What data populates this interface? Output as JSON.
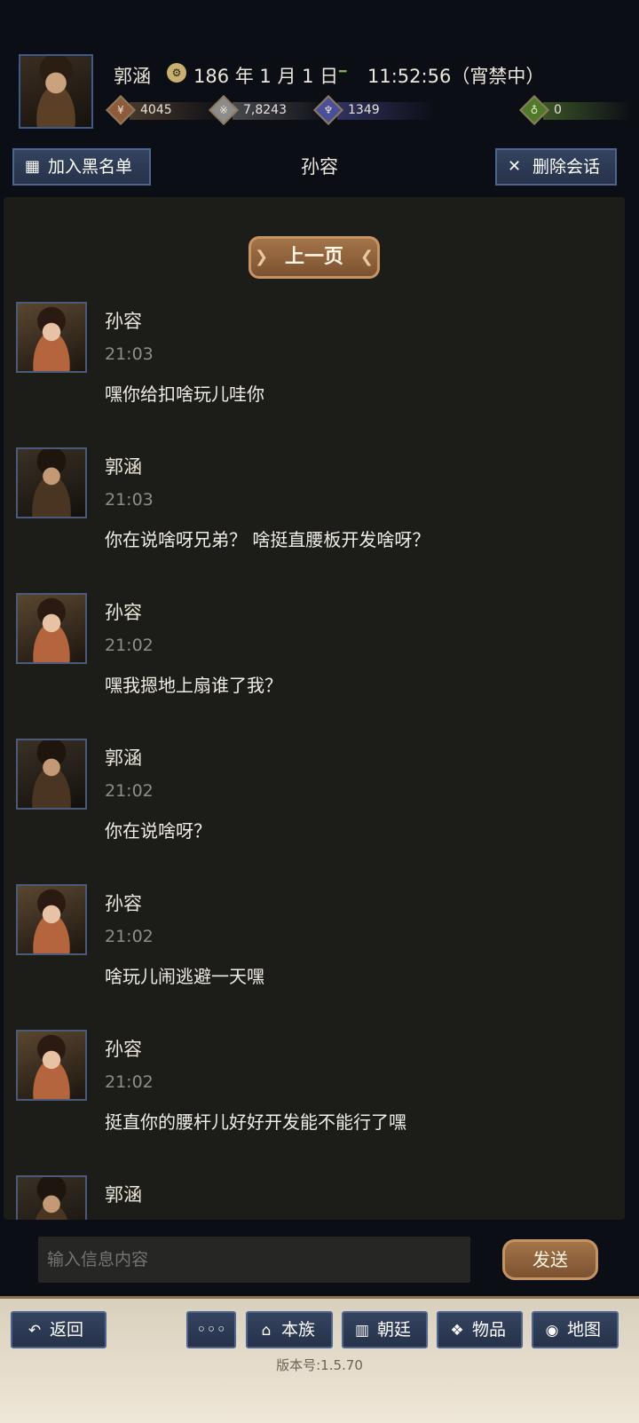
{
  "header": {
    "player_name": "郭涵",
    "date": "186 年 1 月 1 日",
    "time": "11:52:56（宵禁中）",
    "resources": [
      {
        "icon": "coin-icon",
        "value": "4045",
        "color": "#8d5a3c"
      },
      {
        "icon": "grain-icon",
        "value": "7,8243",
        "color": "#8c8c8c"
      },
      {
        "icon": "soldier-icon",
        "value": "1349",
        "color": "#4b4f9a"
      },
      {
        "icon": "pouch-icon",
        "value": "0",
        "color": "#4e7a2a"
      }
    ]
  },
  "toolbar": {
    "blacklist_label": "加入黑名单",
    "conversation_title": "孙容",
    "delete_label": "删除会话"
  },
  "chat": {
    "prev_page_label": "上一页",
    "messages": [
      {
        "sender": "孙容",
        "time": "21:03",
        "text": "嘿你给扣啥玩儿哇你",
        "avatar": "female"
      },
      {
        "sender": "郭涵",
        "time": "21:03",
        "text": "你在说啥呀兄弟？ 啥挺直腰板开发啥呀？",
        "avatar": "male"
      },
      {
        "sender": "孙容",
        "time": "21:02",
        "text": "嘿我摁地上扇谁了我？",
        "avatar": "female"
      },
      {
        "sender": "郭涵",
        "time": "21:02",
        "text": "你在说啥呀？",
        "avatar": "male"
      },
      {
        "sender": "孙容",
        "time": "21:02",
        "text": "啥玩儿闹逃避一天嘿",
        "avatar": "female"
      },
      {
        "sender": "孙容",
        "time": "21:02",
        "text": "挺直你的腰杆儿好好开发能不能行了嘿",
        "avatar": "female"
      },
      {
        "sender": "郭涵",
        "time": "",
        "text": "",
        "avatar": "male"
      }
    ]
  },
  "composer": {
    "placeholder": "输入信息内容",
    "send_label": "发送"
  },
  "nav": {
    "back": "返回",
    "more": "◦◦◦",
    "clan": "本族",
    "court": "朝廷",
    "items": "物品",
    "map": "地图"
  },
  "version": "版本号:1.5.70"
}
